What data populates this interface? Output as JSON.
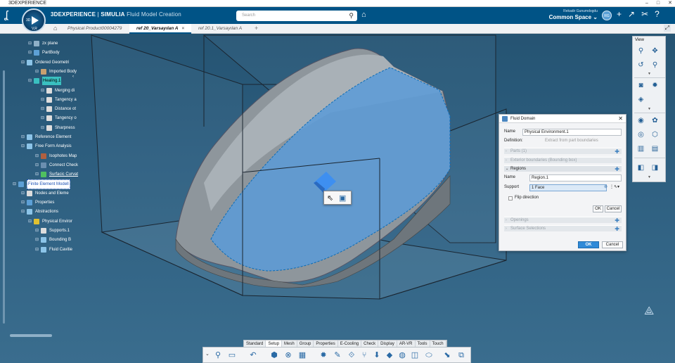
{
  "window": {
    "title": "3DEXPERIENCE",
    "controls": [
      "–",
      "□",
      "✕"
    ]
  },
  "topbar": {
    "brand": "3DEXPERIENCE",
    "separator": " | ",
    "product": "SIMULIA",
    "app": "Fluid Model Creation",
    "search_placeholder": "Search",
    "user_name": "Rekadir Gunumdogdu",
    "space": "Common Space",
    "avatar": "RG",
    "compass": {
      "top": "3D",
      "bottom": "V,R",
      "play": "▶"
    },
    "icons": [
      "+",
      "↗",
      "✂",
      "?"
    ]
  },
  "tabs": {
    "items": [
      {
        "label": "Physical Product00004279",
        "active": false
      },
      {
        "label": "ref 20_Varsayılan A",
        "active": true
      },
      {
        "label": "ref 20.1_Varsayılan A",
        "active": false
      }
    ],
    "plus": "+",
    "close": "×"
  },
  "tree": {
    "nodes": [
      {
        "label": "zx plane",
        "icon": "plane-icon",
        "level": 3,
        "color": "#8fb0c7"
      },
      {
        "label": "PartBody",
        "icon": "partbody-icon",
        "level": 3,
        "color": "#5da0d6"
      },
      {
        "label": "Ordered Geometri",
        "icon": "geometrical-set-icon",
        "level": 2,
        "color": "#8cc4e8"
      },
      {
        "label": "Imported Body",
        "icon": "body-icon",
        "level": 4,
        "color": "#c8a070"
      },
      {
        "label": "Healing.1",
        "icon": "healing-icon",
        "level": 3,
        "color": "#3ac0c0",
        "selected": true
      },
      {
        "label": "Merging di",
        "icon": "parameter-icon",
        "level": 5,
        "color": "#ddd"
      },
      {
        "label": "Tangency a",
        "icon": "parameter-icon",
        "level": 5,
        "color": "#ddd"
      },
      {
        "label": "Distance ot",
        "icon": "parameter-icon",
        "level": 5,
        "color": "#ddd"
      },
      {
        "label": "Tangency o",
        "icon": "parameter-icon",
        "level": 5,
        "color": "#ddd"
      },
      {
        "label": "Sharpness",
        "icon": "parameter-icon",
        "level": 5,
        "color": "#ddd"
      },
      {
        "label": "Reference Element",
        "icon": "reference-icon",
        "level": 2,
        "color": "#8cc4e8"
      },
      {
        "label": "Free Form Analysis",
        "icon": "analysis-icon",
        "level": 2,
        "color": "#8cc4e8"
      },
      {
        "label": "Isophotes Map",
        "icon": "isophote-icon",
        "level": 4,
        "color": "#b06040"
      },
      {
        "label": "Connect Check",
        "icon": "connect-check-icon",
        "level": 4,
        "color": "#6b8fb0"
      },
      {
        "label": "Surfacic Curvat",
        "icon": "curvature-icon",
        "level": 4,
        "color": "#50c060",
        "underline": true
      },
      {
        "label": "Finite Element Modell",
        "icon": "fem-icon",
        "level": 1,
        "color": "#5da0d6",
        "selected2": true
      },
      {
        "label": "Nodes and Eleme",
        "icon": "nodes-icon",
        "level": 2,
        "color": "#ddd"
      },
      {
        "label": "Properties",
        "icon": "properties-icon",
        "level": 2,
        "color": "#5da0d6"
      },
      {
        "label": "Abstractions",
        "icon": "abstractions-icon",
        "level": 2,
        "color": "#8cc4e8"
      },
      {
        "label": "Physical Enviror",
        "icon": "physical-env-icon",
        "level": 3,
        "color": "#e0c030"
      },
      {
        "label": "Supports.1",
        "icon": "support-icon",
        "level": 4,
        "color": "#ddd"
      },
      {
        "label": "Bounding B",
        "icon": "bounding-box-icon",
        "level": 4,
        "color": "#8cc4e8"
      },
      {
        "label": "Fluid Cavitie",
        "icon": "fluid-cavity-icon",
        "level": 4,
        "color": "#8cc4e8"
      }
    ]
  },
  "view_panel": {
    "title": "View"
  },
  "dialog": {
    "title": "Fluid Domain",
    "name_label": "Name",
    "name_value": "Physical Environment.1",
    "definition_label": "Definition:",
    "definition_value": "Extract from part boundaries",
    "sections": {
      "parts": "Parts (1)",
      "exterior": "Exterior boundaries (Bounding box)",
      "regions": "Regions",
      "openings": "Openings",
      "surface_selections": "Surface Selections"
    },
    "region_name_label": "Name",
    "region_name_value": "Region.1",
    "support_label": "Support",
    "support_value": "1 Face",
    "flip_label": "Flip direction",
    "ok": "OK",
    "cancel": "Cancel"
  },
  "action_tabs": [
    "Standard",
    "Setup",
    "Mesh",
    "Group",
    "Properties",
    "E-Cooling",
    "Check",
    "Display",
    "AR-VR",
    "Tools",
    "Touch"
  ],
  "action_active": "Setup",
  "colors": {
    "brand": "#005386",
    "background": "#2d5e7f",
    "selection": "#3ac0c0",
    "face_highlight": "#5a9bd8"
  }
}
